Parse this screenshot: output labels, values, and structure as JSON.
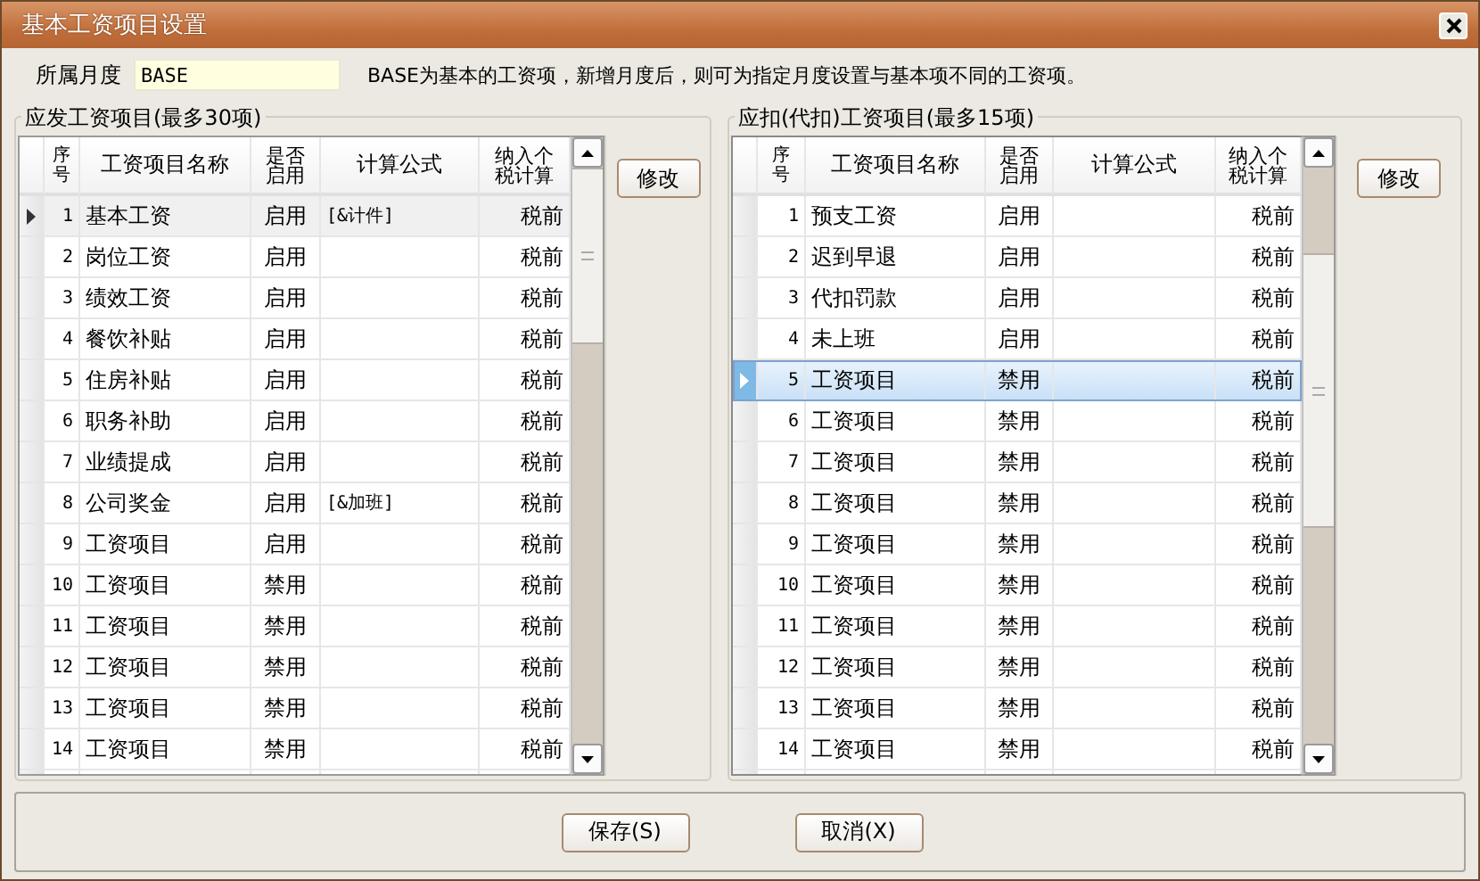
{
  "window": {
    "title": "基本工资项目设置"
  },
  "month": {
    "label": "所属月度",
    "value": "BASE"
  },
  "hint": "BASE为基本的工资项，新增月度后，则可为指定月度设置与基本项不同的工资项。",
  "groups": [
    {
      "title": "应发工资项目(最多30项)",
      "focused": false,
      "edit_button": "修改",
      "columns": [
        "序号",
        "工资项目名称",
        "是否启用",
        "计算公式",
        "纳入个税计算"
      ],
      "rows": [
        {
          "no": "1",
          "name": "基本工资",
          "status": "启用",
          "formula": "[&计件]",
          "tax": "税前",
          "selected": true
        },
        {
          "no": "2",
          "name": "岗位工资",
          "status": "启用",
          "tax": "税前",
          "selected": false
        },
        {
          "no": "3",
          "name": "绩效工资",
          "status": "启用",
          "tax": "税前",
          "selected": false
        },
        {
          "no": "4",
          "name": "餐饮补贴",
          "status": "启用",
          "tax": "税前",
          "selected": false
        },
        {
          "no": "5",
          "name": "住房补贴",
          "status": "启用",
          "tax": "税前",
          "selected": false
        },
        {
          "no": "6",
          "name": "职务补助",
          "status": "启用",
          "tax": "税前",
          "selected": false
        },
        {
          "no": "7",
          "name": "业绩提成",
          "status": "启用",
          "tax": "税前",
          "selected": false
        },
        {
          "no": "8",
          "name": "公司奖金",
          "status": "启用",
          "formula": "[&加班]",
          "tax": "税前",
          "selected": false
        },
        {
          "no": "9",
          "name": "工资项目",
          "status": "启用",
          "tax": "税前",
          "selected": false
        },
        {
          "no": "10",
          "name": "工资项目",
          "status": "禁用",
          "tax": "税前",
          "selected": false
        },
        {
          "no": "11",
          "name": "工资项目",
          "status": "禁用",
          "tax": "税前",
          "selected": false
        },
        {
          "no": "12",
          "name": "工资项目",
          "status": "禁用",
          "tax": "税前",
          "selected": false
        },
        {
          "no": "13",
          "name": "工资项目",
          "status": "禁用",
          "tax": "税前",
          "selected": false
        },
        {
          "no": "14",
          "name": "工资项目",
          "status": "禁用",
          "tax": "税前",
          "selected": false
        }
      ]
    },
    {
      "title": "应扣(代扣)工资项目(最多15项)",
      "focused": true,
      "edit_button": "修改",
      "columns": [
        "序号",
        "工资项目名称",
        "是否启用",
        "计算公式",
        "纳入个税计算"
      ],
      "rows": [
        {
          "no": "1",
          "name": "预支工资",
          "status": "启用",
          "tax": "税前",
          "selected": false
        },
        {
          "no": "2",
          "name": "迟到早退",
          "status": "启用",
          "tax": "税前",
          "selected": false
        },
        {
          "no": "3",
          "name": "代扣罚款",
          "status": "启用",
          "tax": "税前",
          "selected": false
        },
        {
          "no": "4",
          "name": "未上班",
          "status": "启用",
          "tax": "税前",
          "selected": false
        },
        {
          "no": "5",
          "name": "工资项目",
          "status": "禁用",
          "tax": "税前",
          "selected": true
        },
        {
          "no": "6",
          "name": "工资项目",
          "status": "禁用",
          "tax": "税前",
          "selected": false
        },
        {
          "no": "7",
          "name": "工资项目",
          "status": "禁用",
          "tax": "税前",
          "selected": false
        },
        {
          "no": "8",
          "name": "工资项目",
          "status": "禁用",
          "tax": "税前",
          "selected": false
        },
        {
          "no": "9",
          "name": "工资项目",
          "status": "禁用",
          "tax": "税前",
          "selected": false
        },
        {
          "no": "10",
          "name": "工资项目",
          "status": "禁用",
          "tax": "税前",
          "selected": false
        },
        {
          "no": "11",
          "name": "工资项目",
          "status": "禁用",
          "tax": "税前",
          "selected": false
        },
        {
          "no": "12",
          "name": "工资项目",
          "status": "禁用",
          "tax": "税前",
          "selected": false
        },
        {
          "no": "13",
          "name": "工资项目",
          "status": "禁用",
          "tax": "税前",
          "selected": false
        },
        {
          "no": "14",
          "name": "工资项目",
          "status": "禁用",
          "tax": "税前",
          "selected": false
        }
      ]
    }
  ],
  "buttons": [
    "保存(S)",
    "取消(X)"
  ]
}
